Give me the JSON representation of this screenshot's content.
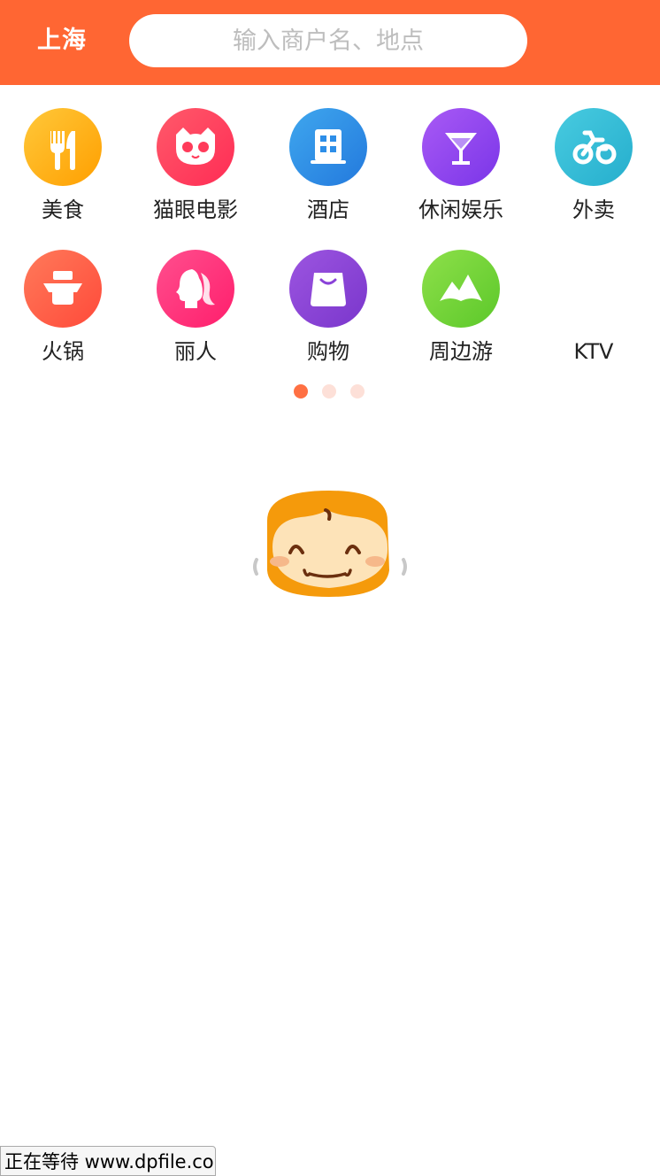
{
  "header": {
    "city": "上海",
    "search_placeholder": "输入商户名、地点",
    "bg_color": "#ff6633"
  },
  "categories": [
    {
      "label": "美食",
      "icon": "fork-knife-icon",
      "color": "#ffb300"
    },
    {
      "label": "猫眼电影",
      "icon": "cat-face-icon",
      "color": "#ff3b5a"
    },
    {
      "label": "酒店",
      "icon": "building-icon",
      "color": "#2d8ee8"
    },
    {
      "label": "休闲娱乐",
      "icon": "cocktail-glass-icon",
      "color": "#8b46ef"
    },
    {
      "label": "外卖",
      "icon": "scooter-icon",
      "color": "#2bbcd6"
    },
    {
      "label": "火锅",
      "icon": "hotpot-icon",
      "color": "#ff5a4a"
    },
    {
      "label": "丽人",
      "icon": "woman-profile-icon",
      "color": "#ff2f7e"
    },
    {
      "label": "购物",
      "icon": "shopping-bag-icon",
      "color": "#8a42d8"
    },
    {
      "label": "周边游",
      "icon": "mountain-icon",
      "color": "#6fd335"
    },
    {
      "label": "KTV",
      "icon": "ktv-icon",
      "color": "#ffffff"
    }
  ],
  "pagination": {
    "pages": 3,
    "active_index": 0,
    "active_color": "#ff7043",
    "inactive_color": "#fde0d8"
  },
  "loading_mascot": {
    "icon": "smiling-mascot-icon"
  },
  "status_bar": {
    "text": "正在等待 www.dpfile.co"
  }
}
